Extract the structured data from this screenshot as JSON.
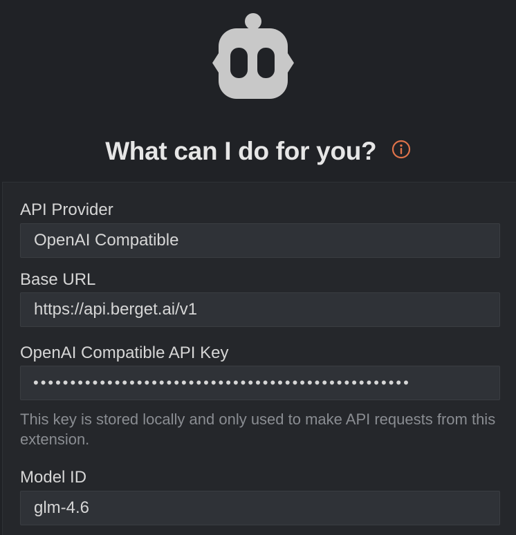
{
  "header": {
    "title": "What can I do for you?",
    "icons": {
      "logo": "robot-icon",
      "info": "info-icon"
    },
    "info_icon_color": "#e0734a"
  },
  "settings": {
    "api_provider": {
      "label": "API Provider",
      "value": "OpenAI Compatible"
    },
    "base_url": {
      "label": "Base URL",
      "value": "https://api.berget.ai/v1"
    },
    "api_key": {
      "label": "OpenAI Compatible API Key",
      "masked_value": "•••••••••••••••••••••••••••••••••••••••••••••••••••",
      "helper": "This key is stored locally and only used to make API requests from this extension."
    },
    "model_id": {
      "label": "Model ID",
      "value": "glm-4.6"
    }
  }
}
